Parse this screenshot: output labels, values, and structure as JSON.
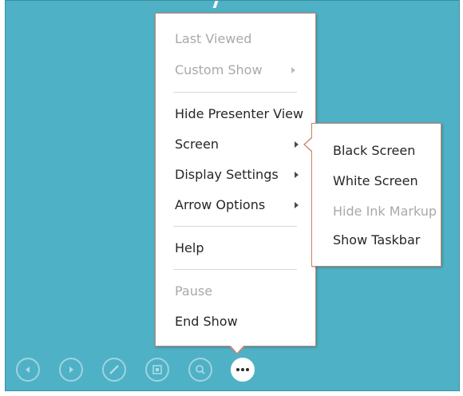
{
  "main_menu": {
    "items": [
      {
        "label": "Last Viewed",
        "enabled": false,
        "submenu": false
      },
      {
        "label": "Custom Show",
        "enabled": false,
        "submenu": true
      },
      {
        "label": "Hide Presenter View",
        "enabled": true,
        "submenu": false
      },
      {
        "label": "Screen",
        "enabled": true,
        "submenu": true
      },
      {
        "label": "Display Settings",
        "enabled": true,
        "submenu": true
      },
      {
        "label": "Arrow Options",
        "enabled": true,
        "submenu": true
      },
      {
        "label": "Help",
        "enabled": true,
        "submenu": false
      },
      {
        "label": "Pause",
        "enabled": false,
        "submenu": false
      },
      {
        "label": "End Show",
        "enabled": true,
        "submenu": false
      }
    ]
  },
  "screen_submenu": {
    "items": [
      {
        "label": "Black Screen",
        "enabled": true
      },
      {
        "label": "White Screen",
        "enabled": true
      },
      {
        "label": "Hide Ink Markup",
        "enabled": false
      },
      {
        "label": "Show Taskbar",
        "enabled": true
      }
    ]
  },
  "toolbar": {
    "buttons": [
      {
        "icon": "previous-icon"
      },
      {
        "icon": "next-icon"
      },
      {
        "icon": "pen-icon"
      },
      {
        "icon": "see-all-slides-icon"
      },
      {
        "icon": "zoom-icon"
      },
      {
        "icon": "more-options-icon"
      }
    ]
  },
  "colors": {
    "slide_background": "#4fb1c6",
    "menu_border": "#c9856e",
    "disabled_text": "#a9a9a9"
  }
}
